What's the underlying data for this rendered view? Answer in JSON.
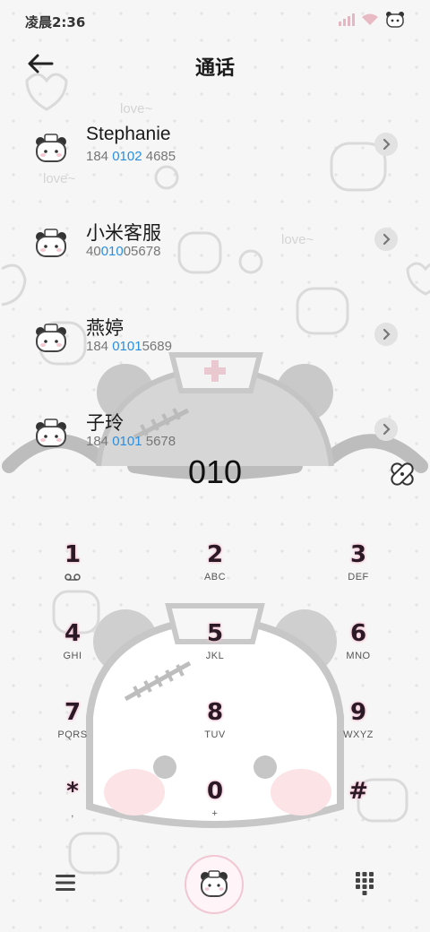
{
  "status_bar": {
    "time": "凌晨2:36"
  },
  "header": {
    "title": "通话"
  },
  "contacts": [
    {
      "name": "Stephanie",
      "number_pre": "184 ",
      "number_match": "0102",
      "number_post": " 4685"
    },
    {
      "name": "小米客服",
      "number_pre": "40",
      "number_match": "010",
      "number_post": "05678"
    },
    {
      "name": "燕婷",
      "number_pre": "184 ",
      "number_match": "0101",
      "number_post": "5689"
    },
    {
      "name": "子玲",
      "number_pre": "184 ",
      "number_match": "0101",
      "number_post": " 5678"
    }
  ],
  "dialer": {
    "input": "010"
  },
  "keypad": [
    {
      "digit": "1",
      "letters": ""
    },
    {
      "digit": "2",
      "letters": "ABC"
    },
    {
      "digit": "3",
      "letters": "DEF"
    },
    {
      "digit": "4",
      "letters": "GHI"
    },
    {
      "digit": "5",
      "letters": "JKL"
    },
    {
      "digit": "6",
      "letters": "MNO"
    },
    {
      "digit": "7",
      "letters": "PQRS"
    },
    {
      "digit": "8",
      "letters": "TUV"
    },
    {
      "digit": "9",
      "letters": "WXYZ"
    },
    {
      "digit": "*",
      "letters": ","
    },
    {
      "digit": "0",
      "letters": "+"
    },
    {
      "digit": "#",
      "letters": ""
    }
  ],
  "icons": {
    "back": "back-arrow-icon",
    "chevron": "chevron-right-icon",
    "avatar": "panda-nurse-avatar-icon",
    "clear": "bandage-clear-icon",
    "voicemail": "voicemail-icon",
    "menu": "menu-icon",
    "call": "panda-call-icon",
    "keypad": "keypad-grid-icon"
  },
  "colors": {
    "accent": "#2a8ee0",
    "digit_outline": "#f5c9d8",
    "digit_fill": "#2b1a25",
    "background": "#f6f6f6"
  }
}
